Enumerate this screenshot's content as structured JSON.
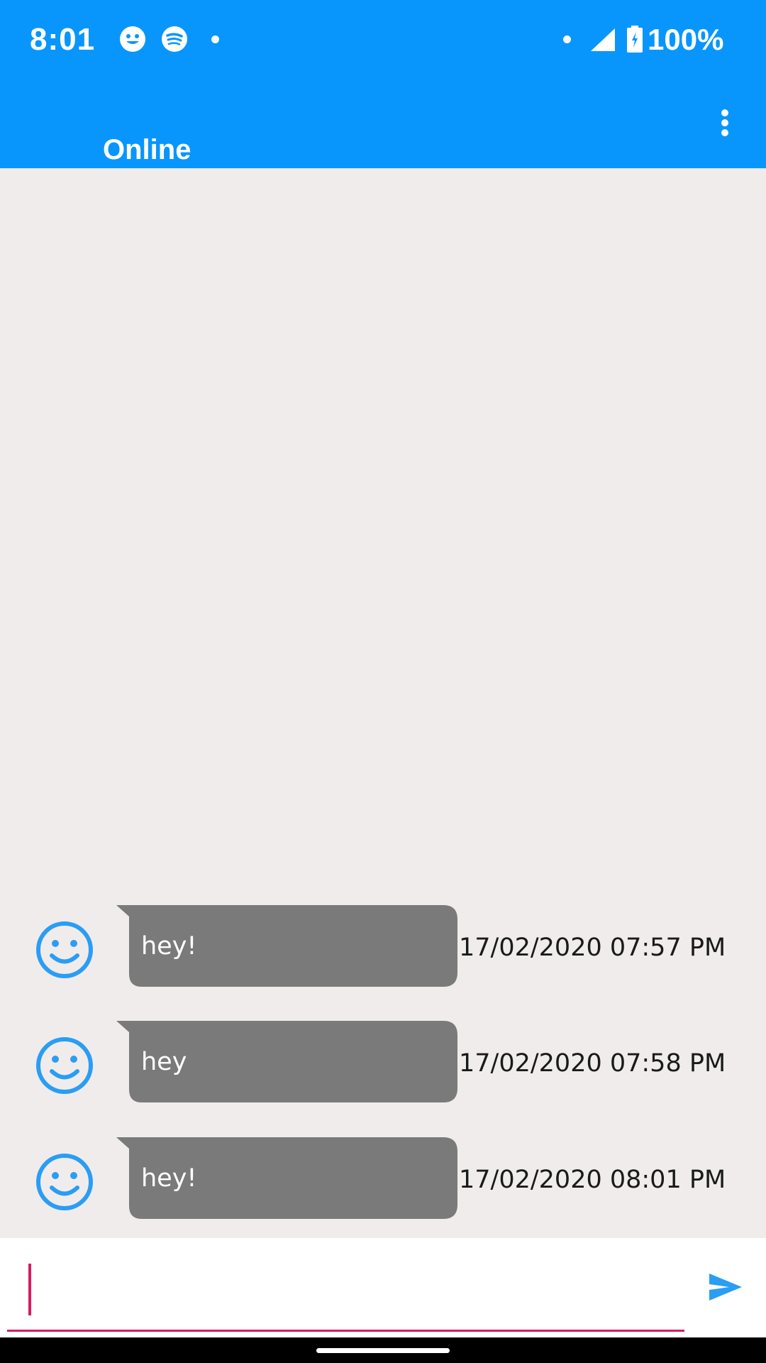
{
  "status_bar": {
    "time": "8:01",
    "battery": "100%",
    "icons": [
      "emoji-notification-icon",
      "spotify-icon",
      "notification-dot-icon",
      "notification-dot-icon",
      "cell-signal-icon",
      "battery-charging-icon"
    ]
  },
  "header": {
    "title": "Online",
    "menu_icon": "overflow-menu-icon"
  },
  "messages": [
    {
      "avatar_icon": "smiley-icon",
      "text": "hey!",
      "timestamp": "17/02/2020 07:57 PM"
    },
    {
      "avatar_icon": "smiley-icon",
      "text": "hey",
      "timestamp": "17/02/2020 07:58 PM"
    },
    {
      "avatar_icon": "smiley-icon",
      "text": "hey!",
      "timestamp": "17/02/2020 08:01 PM"
    }
  ],
  "composer": {
    "value": "",
    "placeholder": "",
    "send_icon": "send-icon"
  },
  "colors": {
    "app_bar": "#0896fc",
    "chat_background": "#f0ecec",
    "bubble": "#7a7a7a",
    "avatar": "#2a9df4",
    "accent": "#d81b60",
    "send": "#2a9df4"
  }
}
